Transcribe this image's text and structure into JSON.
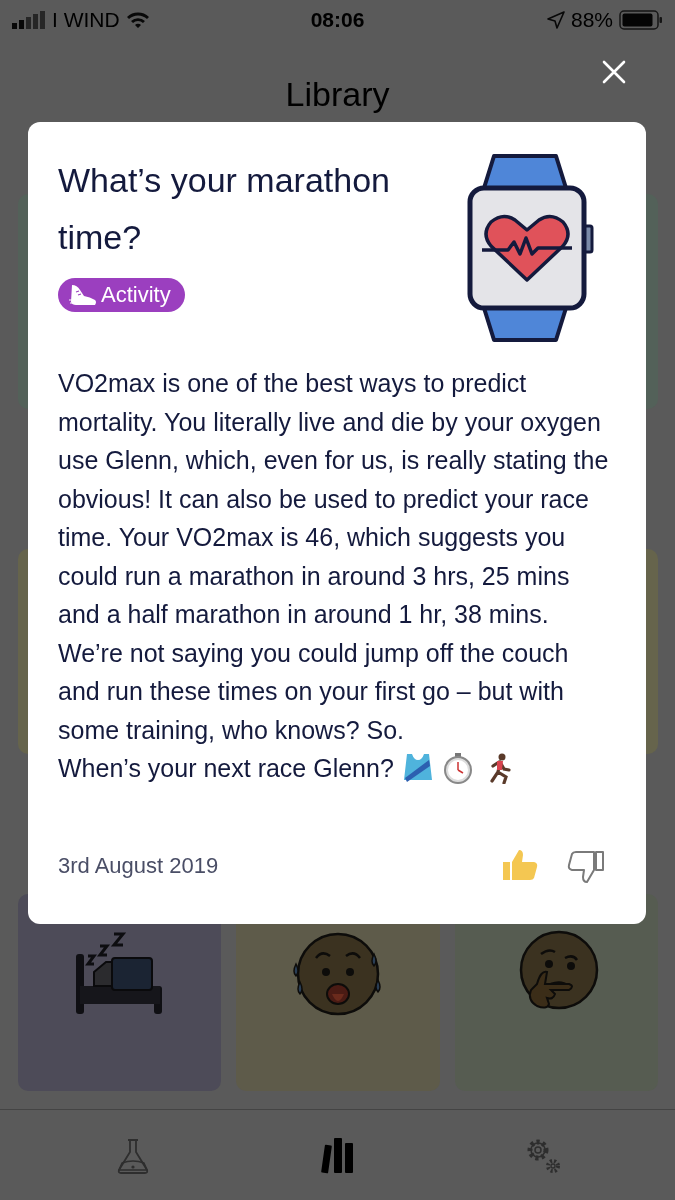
{
  "status_bar": {
    "carrier": "I WIND",
    "time": "08:06",
    "battery": "88%"
  },
  "header": {
    "title": "Library"
  },
  "tiles": [
    {
      "kind": "blank"
    },
    {
      "kind": "blank"
    },
    {
      "kind": "blank"
    },
    {
      "kind": "blank"
    },
    {
      "kind": "sleep"
    },
    {
      "kind": "sweat"
    },
    {
      "kind": "thinking"
    }
  ],
  "dialog": {
    "title": "What’s your marathon time?",
    "tag": "Activity",
    "body": "VO2max is one of the best ways to predict mortality. You literally live and die by your oxygen use Glenn, which, even for us, is really stating the obvious! It can also be used to predict your race time. Your VO2max is 46, which suggests you could run a marathon in around 3 hrs, 25 mins and a half marathon in around 1 hr, 38 mins. We’re not saying you could jump off the couch and run these times on your first go – but with some training, who knows? So.",
    "closing": "When’s your next race Glenn?",
    "emoji": [
      {
        "kind": "shirt"
      },
      {
        "kind": "stopwatch"
      },
      {
        "kind": "runner"
      }
    ],
    "date": "3rd August 2019",
    "reactions": [
      {
        "kind": "like",
        "selected": true
      },
      {
        "kind": "dislike",
        "selected": false
      }
    ]
  },
  "tab_bar": [
    {
      "kind": "lab",
      "selected": false
    },
    {
      "kind": "library",
      "selected": true
    },
    {
      "kind": "settings",
      "selected": false
    }
  ]
}
